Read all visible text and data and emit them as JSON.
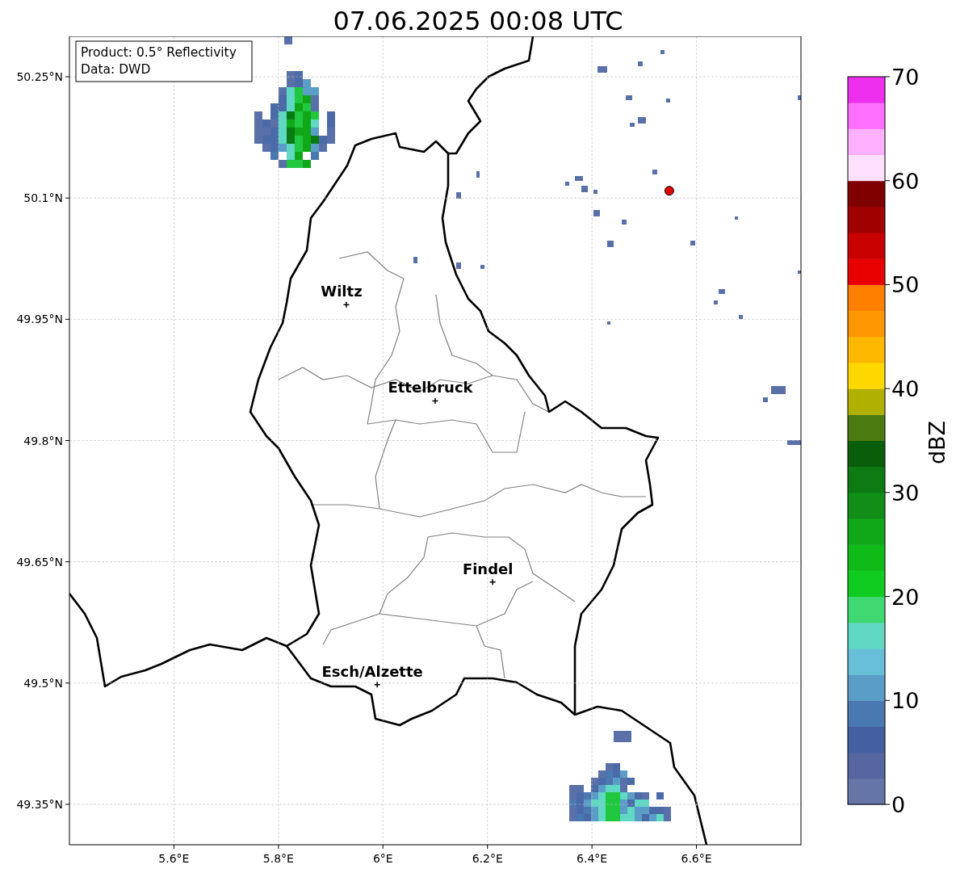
{
  "title": "07.06.2025 00:08 UTC",
  "map": {
    "info_box": [
      "Product: 0.5° Reflectivity",
      "Data: DWD"
    ],
    "chart_data": {
      "type": "scatter",
      "grid": true,
      "xlim": [
        5.4,
        6.8
      ],
      "ylim": [
        49.3,
        50.3
      ],
      "xticks": [
        {
          "value": 5.6,
          "label": "5.6°E"
        },
        {
          "value": 5.8,
          "label": "5.8°E"
        },
        {
          "value": 6.0,
          "label": "6°E"
        },
        {
          "value": 6.2,
          "label": "6.2°E"
        },
        {
          "value": 6.4,
          "label": "6.4°E"
        },
        {
          "value": 6.6,
          "label": "6.6°E"
        }
      ],
      "yticks": [
        {
          "value": 50.25,
          "label": "50.25°N"
        },
        {
          "value": 50.1,
          "label": "50.1°N"
        },
        {
          "value": 49.95,
          "label": "49.95°N"
        },
        {
          "value": 49.8,
          "label": "49.8°N"
        },
        {
          "value": 49.65,
          "label": "49.65°N"
        },
        {
          "value": 49.5,
          "label": "49.5°N"
        },
        {
          "value": 49.35,
          "label": "49.35°N"
        }
      ],
      "series": [
        {
          "color": "#e00000",
          "x": [
            6.548
          ],
          "values": [
            50.109
          ]
        },
        {
          "name": "Wiltz",
          "x": [
            5.93
          ],
          "values": [
            49.968
          ]
        },
        {
          "name": "Ettelbruck",
          "x": [
            6.1
          ],
          "values": [
            49.849
          ]
        },
        {
          "name": "Findel",
          "x": [
            6.21
          ],
          "values": [
            49.625
          ]
        },
        {
          "name": "Esch/Alzette",
          "x": [
            5.989
          ],
          "values": [
            49.498
          ]
        }
      ]
    }
  },
  "colorbar": {
    "label": "dBZ",
    "ticks": [
      "70",
      "60",
      "50",
      "40",
      "30",
      "20",
      "10",
      "0"
    ],
    "bins": [
      {
        "color": "#6575a8"
      },
      {
        "color": "#5566a0"
      },
      {
        "color": "#4560a0"
      },
      {
        "color": "#4a78b0"
      },
      {
        "color": "#5a9ec8"
      },
      {
        "color": "#68c0d8"
      },
      {
        "color": "#60d8c4"
      },
      {
        "color": "#40d870"
      },
      {
        "color": "#10cc20"
      },
      {
        "color": "#10bb18"
      },
      {
        "color": "#10a818"
      },
      {
        "color": "#108e18"
      },
      {
        "color": "#0e7a14"
      },
      {
        "color": "#0a5e0a"
      },
      {
        "color": "#4a7a10"
      },
      {
        "color": "#b0b000"
      },
      {
        "color": "#ffd800"
      },
      {
        "color": "#ffb800"
      },
      {
        "color": "#ff9800"
      },
      {
        "color": "#ff8000"
      },
      {
        "color": "#e80000"
      },
      {
        "color": "#c80000"
      },
      {
        "color": "#a00000"
      },
      {
        "color": "#800000"
      },
      {
        "color": "#ffe0ff"
      },
      {
        "color": "#ffb0ff"
      },
      {
        "color": "#ff70ff"
      },
      {
        "color": "#ee30ee"
      }
    ]
  }
}
